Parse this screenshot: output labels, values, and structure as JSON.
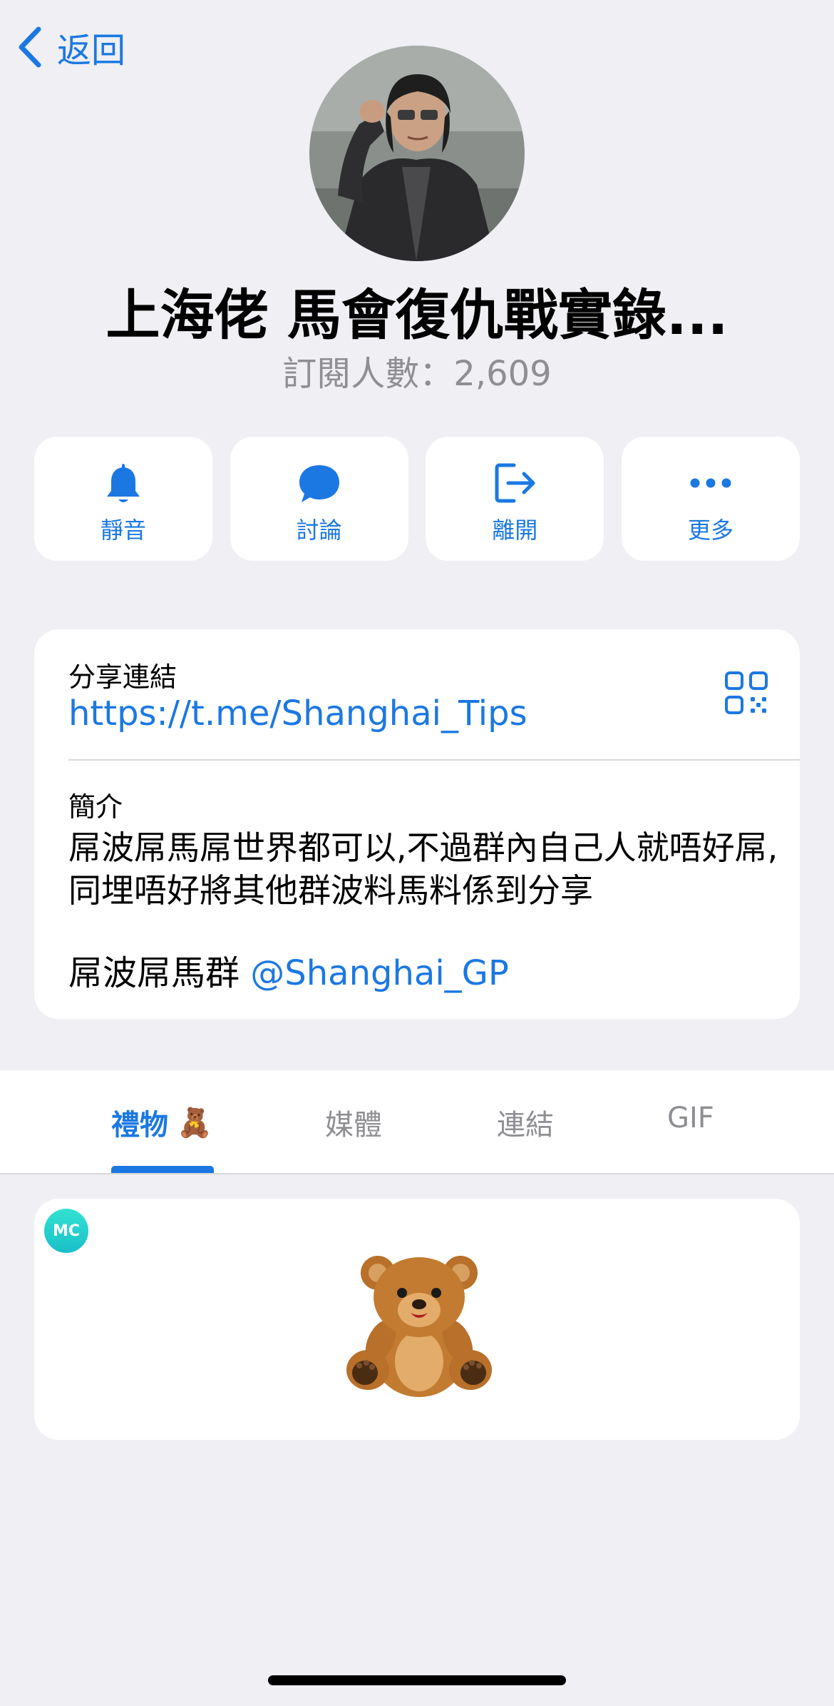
{
  "nav": {
    "back_label": "返回"
  },
  "channel": {
    "title": "上海佬 馬會復仇戰實錄...",
    "subscribers": "訂閱人數：2,609"
  },
  "actions": [
    {
      "label": "靜音",
      "icon": "bell-icon"
    },
    {
      "label": "討論",
      "icon": "chat-bubble-icon"
    },
    {
      "label": "離開",
      "icon": "leave-icon"
    },
    {
      "label": "更多",
      "icon": "more-icon"
    }
  ],
  "info": {
    "share_label": "分享連結",
    "share_link": "https://t.me/Shanghai_Tips",
    "bio_label": "簡介",
    "bio_text": "屌波屌馬屌世界都可以,不過群內自己人就唔好屌,同埋唔好將其他群波料馬料係到分享",
    "group_label": "屌波屌馬群",
    "group_mention": "@Shanghai_GP"
  },
  "tabs": [
    {
      "label": "禮物",
      "emoji": "🧸",
      "active": true
    },
    {
      "label": "媒體",
      "active": false
    },
    {
      "label": "連結",
      "active": false
    },
    {
      "label": "GIF",
      "active": false
    }
  ],
  "gift": {
    "sender_initials": "MC",
    "item": "teddy-bear"
  },
  "colors": {
    "accent": "#1b78e2",
    "background": "#efeff4",
    "secondary_text": "#8e8e93"
  }
}
